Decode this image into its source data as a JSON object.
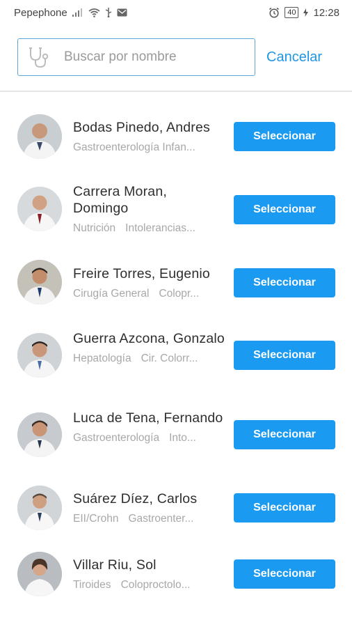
{
  "status_bar": {
    "carrier": "Pepephone",
    "battery": "40",
    "time": "12:28"
  },
  "search": {
    "placeholder": "Buscar por nombre",
    "value": "",
    "icon": "stethoscope-icon",
    "cancel_label": "Cancelar"
  },
  "colors": {
    "accent": "#1a9af0",
    "search_border": "#5ba8d8"
  },
  "doctors": [
    {
      "name": "Bodas Pinedo, Andres",
      "specialties": [
        "Gastroenterología Infan..."
      ],
      "button": "Seleccionar"
    },
    {
      "name": "Carrera Moran, Domingo",
      "specialties": [
        "Nutrición",
        "Intolerancias..."
      ],
      "button": "Seleccionar"
    },
    {
      "name": "Freire Torres, Eugenio",
      "specialties": [
        "Cirugía General",
        "Colopr..."
      ],
      "button": "Seleccionar"
    },
    {
      "name": "Guerra Azcona, Gonzalo",
      "specialties": [
        "Hepatología",
        "Cir. Colorr..."
      ],
      "button": "Seleccionar"
    },
    {
      "name": "Luca de Tena, Fernando",
      "specialties": [
        "Gastroenterología",
        "Into..."
      ],
      "button": "Seleccionar"
    },
    {
      "name": "Suárez Díez, Carlos",
      "specialties": [
        "EII/Crohn",
        "Gastroenter..."
      ],
      "button": "Seleccionar"
    },
    {
      "name": "Villar Riu, Sol",
      "specialties": [
        "Tiroides",
        "Coloproctolo..."
      ],
      "button": "Seleccionar"
    }
  ]
}
